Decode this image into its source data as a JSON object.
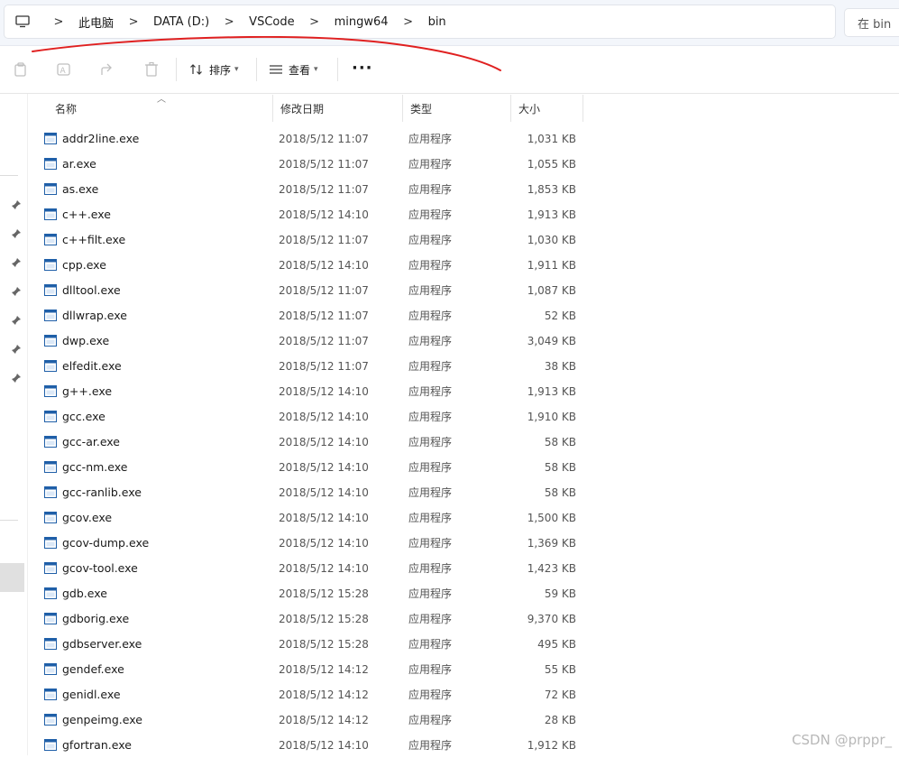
{
  "breadcrumb": {
    "items": [
      "此电脑",
      "DATA (D:)",
      "VSCode",
      "mingw64",
      "bin"
    ],
    "separator": ">"
  },
  "search": {
    "placeholder": "在 bin 中搜索",
    "visible_text": "在 bin"
  },
  "toolbar": {
    "icons": [
      "copy-icon",
      "rename-icon",
      "share-icon",
      "delete-icon"
    ],
    "sort_label": "排序",
    "view_label": "查看",
    "more_label": "···"
  },
  "columns": {
    "name": "名称",
    "date": "修改日期",
    "type": "类型",
    "size": "大小"
  },
  "files": [
    {
      "name": "addr2line.exe",
      "date": "2018/5/12 11:07",
      "type": "应用程序",
      "size": "1,031 KB"
    },
    {
      "name": "ar.exe",
      "date": "2018/5/12 11:07",
      "type": "应用程序",
      "size": "1,055 KB"
    },
    {
      "name": "as.exe",
      "date": "2018/5/12 11:07",
      "type": "应用程序",
      "size": "1,853 KB"
    },
    {
      "name": "c++.exe",
      "date": "2018/5/12 14:10",
      "type": "应用程序",
      "size": "1,913 KB"
    },
    {
      "name": "c++filt.exe",
      "date": "2018/5/12 11:07",
      "type": "应用程序",
      "size": "1,030 KB"
    },
    {
      "name": "cpp.exe",
      "date": "2018/5/12 14:10",
      "type": "应用程序",
      "size": "1,911 KB"
    },
    {
      "name": "dlltool.exe",
      "date": "2018/5/12 11:07",
      "type": "应用程序",
      "size": "1,087 KB"
    },
    {
      "name": "dllwrap.exe",
      "date": "2018/5/12 11:07",
      "type": "应用程序",
      "size": "52 KB"
    },
    {
      "name": "dwp.exe",
      "date": "2018/5/12 11:07",
      "type": "应用程序",
      "size": "3,049 KB"
    },
    {
      "name": "elfedit.exe",
      "date": "2018/5/12 11:07",
      "type": "应用程序",
      "size": "38 KB"
    },
    {
      "name": "g++.exe",
      "date": "2018/5/12 14:10",
      "type": "应用程序",
      "size": "1,913 KB"
    },
    {
      "name": "gcc.exe",
      "date": "2018/5/12 14:10",
      "type": "应用程序",
      "size": "1,910 KB"
    },
    {
      "name": "gcc-ar.exe",
      "date": "2018/5/12 14:10",
      "type": "应用程序",
      "size": "58 KB"
    },
    {
      "name": "gcc-nm.exe",
      "date": "2018/5/12 14:10",
      "type": "应用程序",
      "size": "58 KB"
    },
    {
      "name": "gcc-ranlib.exe",
      "date": "2018/5/12 14:10",
      "type": "应用程序",
      "size": "58 KB"
    },
    {
      "name": "gcov.exe",
      "date": "2018/5/12 14:10",
      "type": "应用程序",
      "size": "1,500 KB"
    },
    {
      "name": "gcov-dump.exe",
      "date": "2018/5/12 14:10",
      "type": "应用程序",
      "size": "1,369 KB"
    },
    {
      "name": "gcov-tool.exe",
      "date": "2018/5/12 14:10",
      "type": "应用程序",
      "size": "1,423 KB"
    },
    {
      "name": "gdb.exe",
      "date": "2018/5/12 15:28",
      "type": "应用程序",
      "size": "59 KB"
    },
    {
      "name": "gdborig.exe",
      "date": "2018/5/12 15:28",
      "type": "应用程序",
      "size": "9,370 KB"
    },
    {
      "name": "gdbserver.exe",
      "date": "2018/5/12 15:28",
      "type": "应用程序",
      "size": "495 KB"
    },
    {
      "name": "gendef.exe",
      "date": "2018/5/12 14:12",
      "type": "应用程序",
      "size": "55 KB"
    },
    {
      "name": "genidl.exe",
      "date": "2018/5/12 14:12",
      "type": "应用程序",
      "size": "72 KB"
    },
    {
      "name": "genpeimg.exe",
      "date": "2018/5/12 14:12",
      "type": "应用程序",
      "size": "28 KB"
    },
    {
      "name": "gfortran.exe",
      "date": "2018/5/12 14:10",
      "type": "应用程序",
      "size": "1,912 KB"
    }
  ],
  "watermark": "CSDN @prppr_",
  "colors": {
    "annotation_red": "#e02020",
    "file_icon_blue": "#1f5fa8"
  }
}
